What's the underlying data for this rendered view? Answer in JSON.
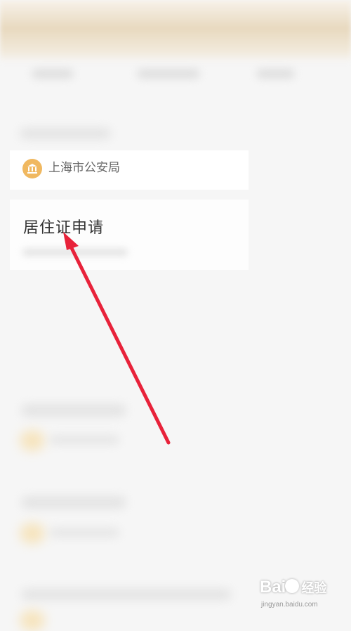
{
  "agency": {
    "name": "上海市公安局",
    "icon": "government-building-icon"
  },
  "service": {
    "title": "居住证申请"
  },
  "annotation": {
    "color": "#e8223a"
  },
  "watermark": {
    "logo": "Bai",
    "logo_suffix": "经验",
    "url": "jingyan.baidu.com"
  },
  "colors": {
    "accent": "#f0b860",
    "header": "#e8d9bf"
  }
}
